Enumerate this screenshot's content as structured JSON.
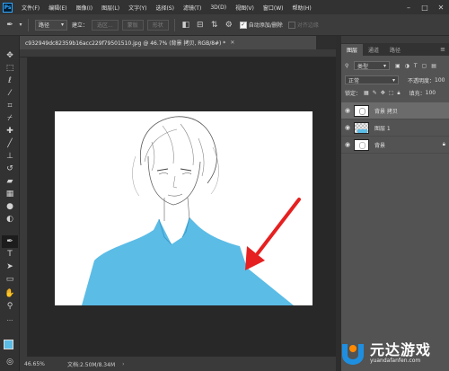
{
  "menubar": {
    "app_logo": "Ps",
    "items": [
      "文件(F)",
      "编辑(E)",
      "图像(I)",
      "图层(L)",
      "文字(Y)",
      "选择(S)",
      "滤镜(T)",
      "3D(D)",
      "视图(V)",
      "窗口(W)",
      "帮助(H)"
    ]
  },
  "options": {
    "path_mode": "路径",
    "make_label": "建立：",
    "selection_btn": "选区...",
    "mask_btn": "蒙版",
    "shape_btn": "形状",
    "auto_add_label": "自动添加/删除",
    "align_edges_label": "对齐边缘"
  },
  "document": {
    "tab_title": "c932949dc82359b16acc229f79501510.jpg @ 46.7% (背景 拷贝, RGB/8#) *",
    "zoom": "46.65%",
    "doc_info": "文档:2.50M/8.34M"
  },
  "panel": {
    "tabs": [
      "图层",
      "通道",
      "路径"
    ],
    "active_tab": "图层",
    "kind_filter": "类型",
    "blend_mode": "正常",
    "opacity_label": "不透明度：",
    "opacity_value": "100",
    "lock_label": "锁定：",
    "fill_label": "填充：",
    "fill_value": "100",
    "layers": [
      {
        "name": "背景 拷贝",
        "selected": true
      },
      {
        "name": "图层 1",
        "selected": false
      },
      {
        "name": "背景",
        "selected": false
      }
    ]
  },
  "watermark": {
    "title": "元达游戏",
    "url": "yuandafanfen.com"
  },
  "colors": {
    "shirt_blue": "#5bbce6",
    "arrow_red": "#e62020",
    "watermark_blue": "#1e8fe0",
    "watermark_orange": "#ff8a00"
  },
  "icons": [
    "pen-tool-icon",
    "move-icon",
    "marquee-icon",
    "lasso-icon",
    "magic-wand-icon",
    "crop-icon",
    "eyedropper-icon",
    "healing-brush-icon",
    "brush-icon",
    "clone-stamp-icon",
    "history-brush-icon",
    "eraser-icon",
    "gradient-icon",
    "blur-icon",
    "dodge-icon",
    "pen-icon",
    "type-icon",
    "path-select-icon",
    "rectangle-icon",
    "hand-icon",
    "zoom-icon",
    "eye-icon",
    "lock-icon"
  ]
}
